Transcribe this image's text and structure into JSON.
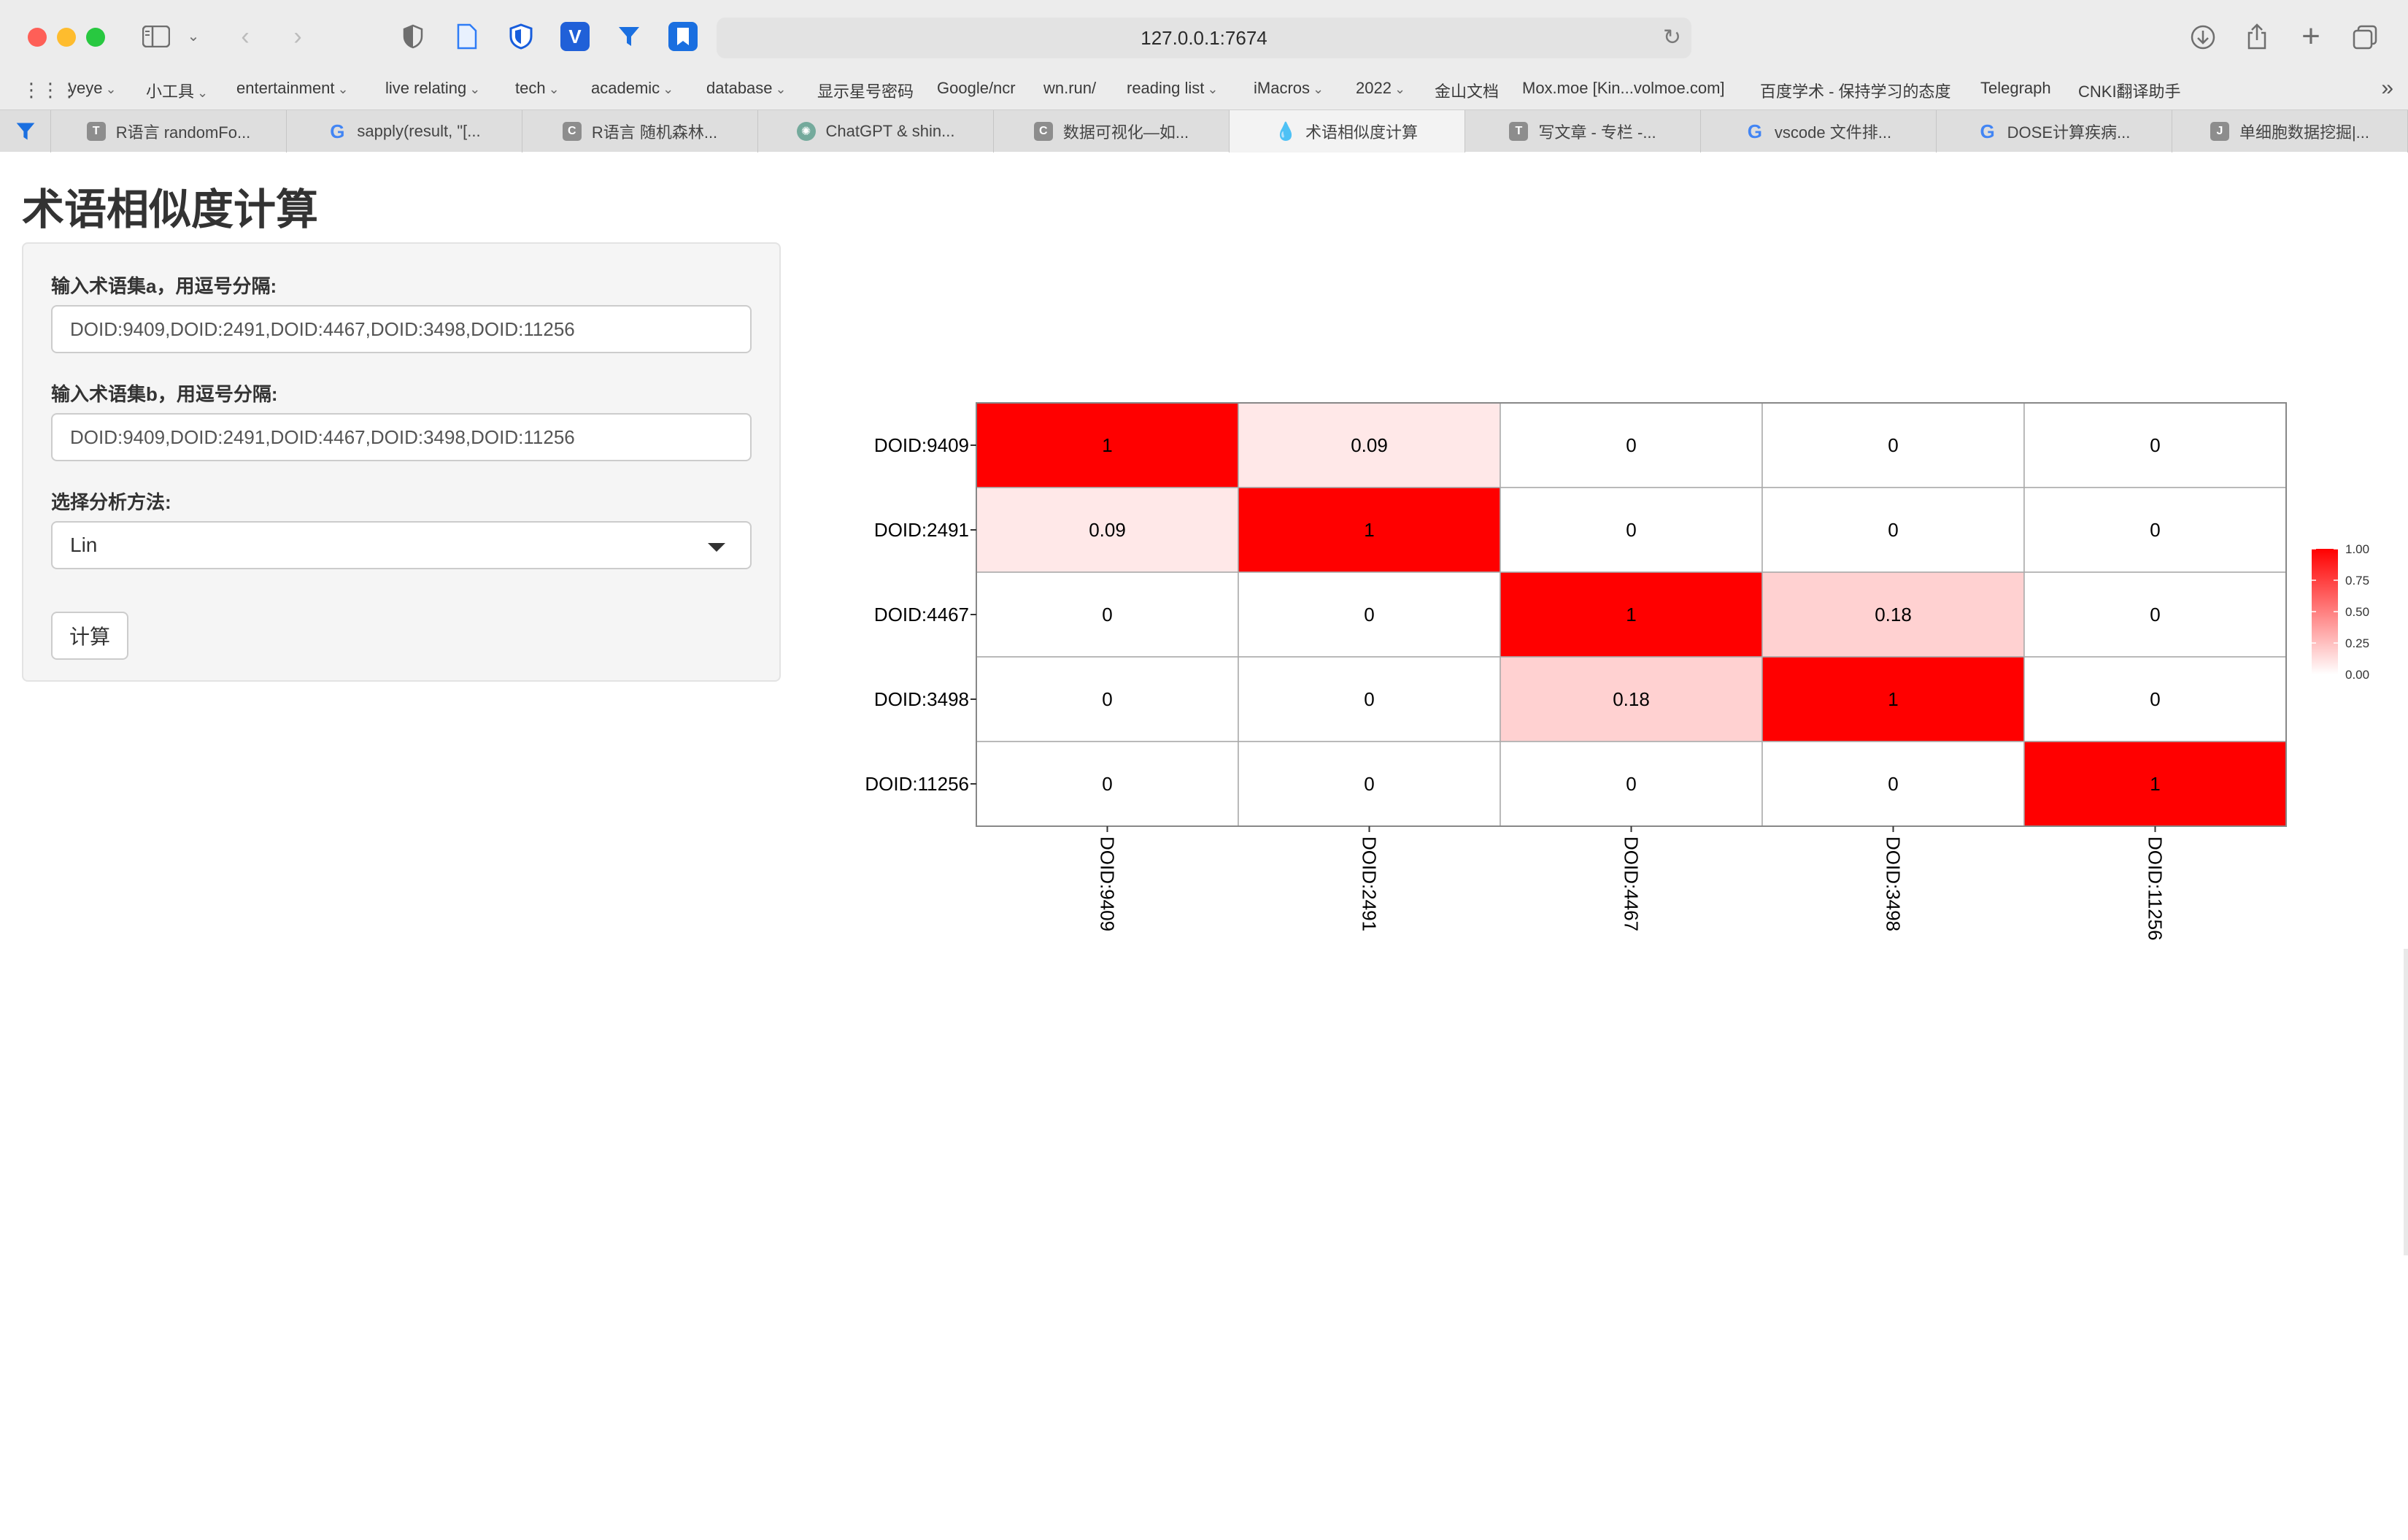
{
  "browser": {
    "url": "127.0.0.1:7674",
    "bookmarks": [
      {
        "label": "yeye",
        "chevron": true
      },
      {
        "label": "小工具",
        "chevron": true
      },
      {
        "label": "entertainment",
        "chevron": true
      },
      {
        "label": "live relating",
        "chevron": true
      },
      {
        "label": "tech",
        "chevron": true
      },
      {
        "label": "academic",
        "chevron": true
      },
      {
        "label": "database",
        "chevron": true
      },
      {
        "label": "显示星号密码",
        "chevron": false
      },
      {
        "label": "Google/ncr",
        "chevron": false
      },
      {
        "label": "wn.run/",
        "chevron": false
      },
      {
        "label": "reading list",
        "chevron": true
      },
      {
        "label": "iMacros",
        "chevron": true
      },
      {
        "label": "2022",
        "chevron": true
      },
      {
        "label": "金山文档",
        "chevron": false
      },
      {
        "label": "Mox.moe [Kin...volmoe.com]",
        "chevron": false
      },
      {
        "label": "百度学术 - 保持学习的态度",
        "chevron": false
      },
      {
        "label": "Telegraph",
        "chevron": false
      },
      {
        "label": "CNKI翻译助手",
        "chevron": false
      }
    ],
    "tabs": [
      {
        "label": "R语言 randomFo...",
        "favicon": "T",
        "active": false
      },
      {
        "label": "sapply(result, \"[...",
        "favicon": "G",
        "active": false
      },
      {
        "label": "R语言 随机森林...",
        "favicon": "C",
        "active": false
      },
      {
        "label": "ChatGPT & shin...",
        "favicon": "gpt",
        "active": false
      },
      {
        "label": "数据可视化—如...",
        "favicon": "C",
        "active": false
      },
      {
        "label": "术语相似度计算",
        "favicon": "drop",
        "active": true
      },
      {
        "label": "写文章 - 专栏 -...",
        "favicon": "T",
        "active": false
      },
      {
        "label": "vscode 文件排...",
        "favicon": "G",
        "active": false
      },
      {
        "label": "DOSE计算疾病...",
        "favicon": "G",
        "active": false
      },
      {
        "label": "单细胞数据挖掘|...",
        "favicon": "J",
        "active": false
      }
    ]
  },
  "app": {
    "title": "术语相似度计算",
    "input_a": {
      "label": "输入术语集a，用逗号分隔:",
      "value": "DOID:9409,DOID:2491,DOID:4467,DOID:3498,DOID:11256"
    },
    "input_b": {
      "label": "输入术语集b，用逗号分隔:",
      "value": "DOID:9409,DOID:2491,DOID:4467,DOID:3498,DOID:11256"
    },
    "method": {
      "label": "选择分析方法:",
      "value": "Lin"
    },
    "calc_button": "计算"
  },
  "chart_data": {
    "type": "heatmap",
    "rows": [
      "DOID:9409",
      "DOID:2491",
      "DOID:4467",
      "DOID:3498",
      "DOID:11256"
    ],
    "cols": [
      "DOID:9409",
      "DOID:2491",
      "DOID:4467",
      "DOID:3498",
      "DOID:11256"
    ],
    "values": [
      [
        1,
        0.09,
        0,
        0,
        0
      ],
      [
        0.09,
        1,
        0,
        0,
        0
      ],
      [
        0,
        0,
        1,
        0.18,
        0
      ],
      [
        0,
        0,
        0.18,
        1,
        0
      ],
      [
        0,
        0,
        0,
        0,
        1
      ]
    ],
    "cell_labels": [
      [
        "1",
        "0.09",
        "0",
        "0",
        "0"
      ],
      [
        "0.09",
        "1",
        "0",
        "0",
        "0"
      ],
      [
        "0",
        "0",
        "1",
        "0.18",
        "0"
      ],
      [
        "0",
        "0",
        "0.18",
        "1",
        "0"
      ],
      [
        "0",
        "0",
        "0",
        "0",
        "1"
      ]
    ],
    "color_low": "#ffffff",
    "color_high": "#ff0000",
    "legend_ticks": [
      "1.00",
      "0.75",
      "0.50",
      "0.25",
      "0.00"
    ],
    "legend_range": [
      0,
      1
    ],
    "legend_position": "right"
  }
}
